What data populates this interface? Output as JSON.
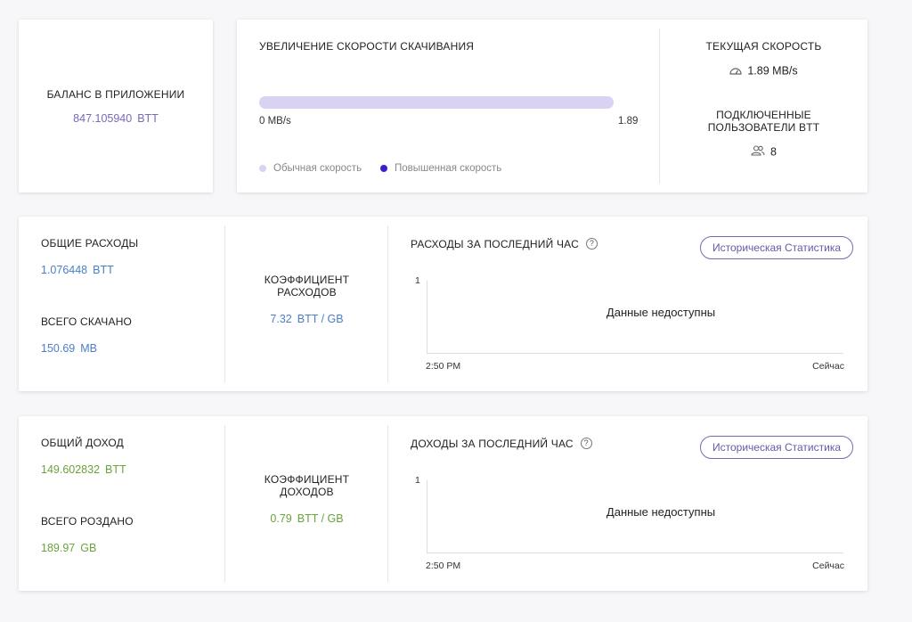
{
  "balance": {
    "label": "БАЛАНС В ПРИЛОЖЕНИИ",
    "value": "847.105940",
    "unit": "BTT"
  },
  "speed": {
    "title": "УВЕЛИЧЕНИЕ СКОРОСТИ СКАЧИВАНИЯ",
    "min_label": "0 MB/s",
    "max_label": "1.89",
    "legend_normal": "Обычная скорость",
    "legend_boosted": "Повышенная скорость",
    "normal_color": "#d9d2f2",
    "boosted_color": "#3a1fcf"
  },
  "current": {
    "speed_label": "ТЕКУЩАЯ СКОРОСТЬ",
    "speed_value": "1.89 MB/s",
    "users_label_line1": "ПОДКЛЮЧЕННЫЕ",
    "users_label_line2": "ПОЛЬЗОВАТЕЛИ BTT",
    "users_value": "8"
  },
  "expenses": {
    "total_label": "ОБЩИЕ РАСХОДЫ",
    "total_value": "1.076448",
    "total_unit": "BTT",
    "downloaded_label": "ВСЕГО СКАЧАНО",
    "downloaded_value": "150.69",
    "downloaded_unit": "MB",
    "ratio_label_line1": "КОЭФФИЦИЕНТ",
    "ratio_label_line2": "РАСХОДОВ",
    "ratio_value": "7.32",
    "ratio_unit": "BTT / GB",
    "chart_title": "РАСХОДЫ ЗА ПОСЛЕДНИЙ ЧАС",
    "history_button": "Историческая Статистика",
    "y_tick": "1",
    "no_data": "Данные недоступны",
    "x_start": "2:50 PM",
    "x_end": "Сейчас"
  },
  "income": {
    "total_label": "ОБЩИЙ ДОХОД",
    "total_value": "149.602832",
    "total_unit": "BTT",
    "given_label": "ВСЕГО РОЗДАНО",
    "given_value": "189.97",
    "given_unit": "GB",
    "ratio_label_line1": "КОЭФФИЦИЕНТ",
    "ratio_label_line2": "ДОХОДОВ",
    "ratio_value": "0.79",
    "ratio_unit": "BTT / GB",
    "chart_title": "ДОХОДЫ ЗА ПОСЛЕДНИЙ ЧАС",
    "history_button": "Историческая Статистика",
    "y_tick": "1",
    "no_data": "Данные недоступны",
    "x_start": "2:50 PM",
    "x_end": "Сейчас"
  }
}
